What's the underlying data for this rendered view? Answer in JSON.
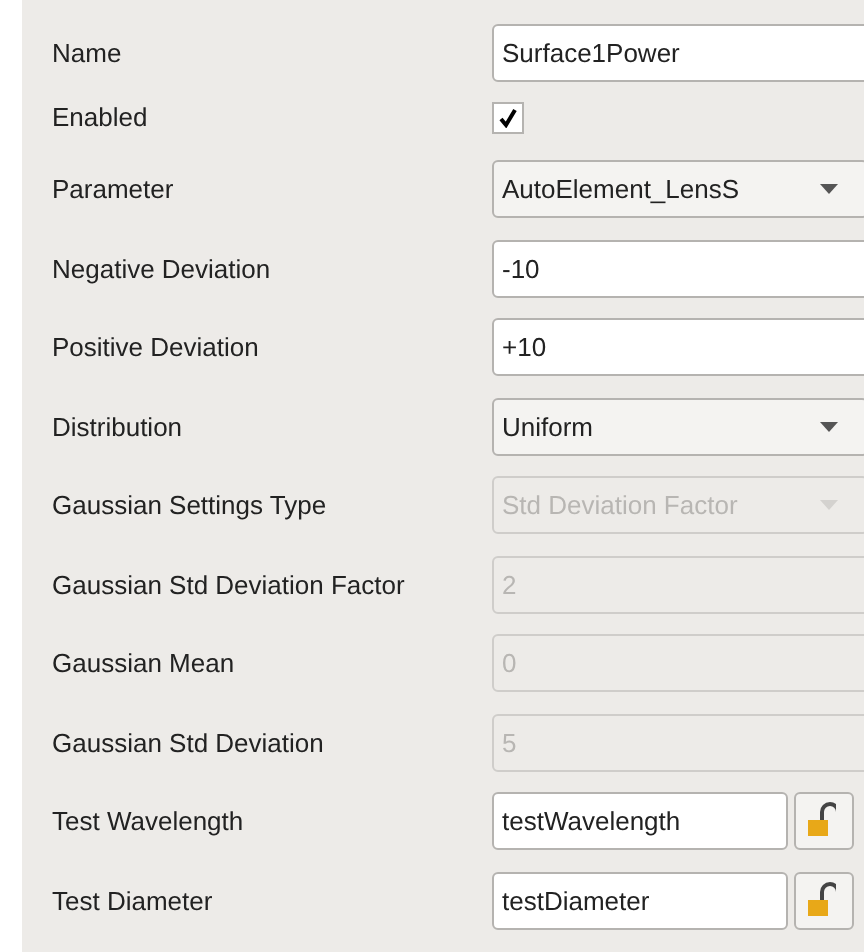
{
  "properties": [
    {
      "label": "Name",
      "kind": "text",
      "value": "Surface1Power",
      "disabled": false
    },
    {
      "label": "Enabled",
      "kind": "checkbox",
      "checked": true
    },
    {
      "label": "Parameter",
      "kind": "combo",
      "value": "AutoElement_LensS",
      "disabled": false
    },
    {
      "label": "Negative Deviation",
      "kind": "text",
      "value": "-10",
      "disabled": false
    },
    {
      "label": "Positive Deviation",
      "kind": "text",
      "value": "+10",
      "disabled": false
    },
    {
      "label": "Distribution",
      "kind": "combo",
      "value": "Uniform",
      "disabled": false
    },
    {
      "label": "Gaussian Settings Type",
      "kind": "combo",
      "value": "Std Deviation Factor",
      "disabled": true
    },
    {
      "label": "Gaussian Std Deviation Factor",
      "kind": "text",
      "value": "2",
      "disabled": true
    },
    {
      "label": "Gaussian Mean",
      "kind": "text",
      "value": "0",
      "disabled": true
    },
    {
      "label": "Gaussian Std Deviation",
      "kind": "text",
      "value": "5",
      "disabled": true
    },
    {
      "label": "Test Wavelength",
      "kind": "lock",
      "value": "testWavelength",
      "disabled": false
    },
    {
      "label": "Test Diameter",
      "kind": "lock",
      "value": "testDiameter",
      "disabled": false
    }
  ]
}
